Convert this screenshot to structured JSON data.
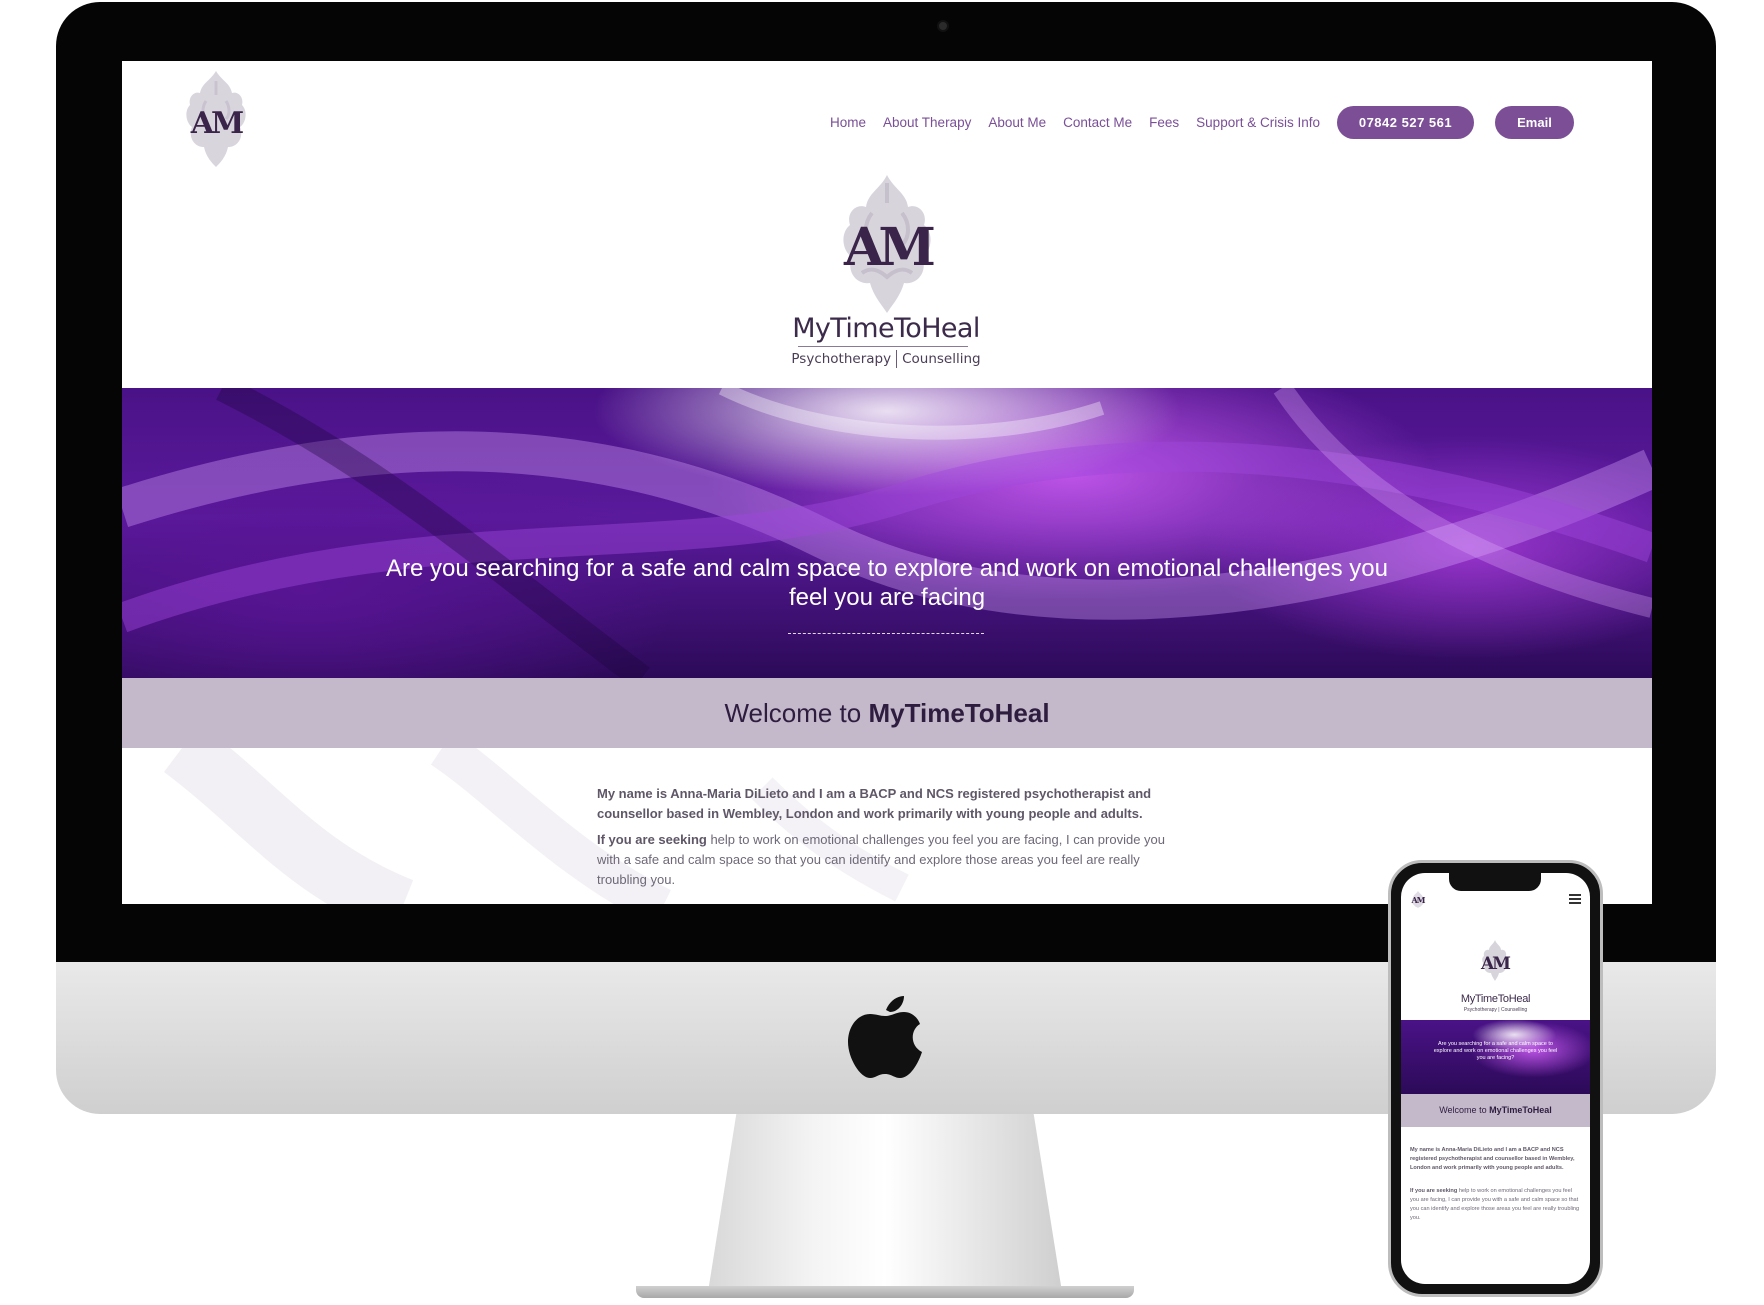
{
  "site": {
    "logo_letters": "AM",
    "brand_name": "MyTimeToHeal",
    "brand_sub_left": "Psychotherapy",
    "brand_sub_right": "Counselling"
  },
  "nav": {
    "items": [
      {
        "label": "Home"
      },
      {
        "label": "About Therapy"
      },
      {
        "label": "About Me"
      },
      {
        "label": "Contact Me"
      },
      {
        "label": "Fees"
      },
      {
        "label": "Support & Crisis Info"
      }
    ],
    "phone_label": "07842 527 561",
    "email_label": "Email"
  },
  "hero": {
    "text": "Are you searching for a safe and calm space to explore and work on emotional challenges you feel you are facing",
    "rule": "------------------------------"
  },
  "welcome": {
    "prefix": "Welcome to ",
    "name": "MyTimeToHeal"
  },
  "content": {
    "para1": "My name is Anna-Maria DiLieto and I am a BACP and NCS registered psychotherapist and counsellor based in Wembley, London and work primarily with young people and adults.",
    "para2_bold": "If you are seeking",
    "para2_rest": " help to work on emotional challenges you feel you are facing, I can provide you with a safe and calm space so that you can identify and explore those areas you feel are really troubling you."
  },
  "mobile": {
    "hero_text": "Are you searching for a safe and calm space to explore and work on emotional challenges you feel you are facing?",
    "welcome_prefix": "Welcome to ",
    "welcome_name": "MyTimeToHeal",
    "para1": "My name is Anna-Maria DiLieto and I am a BACP and NCS registered psychotherapist and counsellor based in Wembley, London and work primarily with young people and adults.",
    "para2_bold": "If you are seeking",
    "para2_rest": " help to work on emotional challenges you feel you are facing, I can provide you with a safe and calm space so that you can identify and explore those areas you feel are really troubling you."
  },
  "colors": {
    "accent": "#7b4e96",
    "band": "#c4b9cb",
    "hero_dark": "#2c0a58"
  }
}
